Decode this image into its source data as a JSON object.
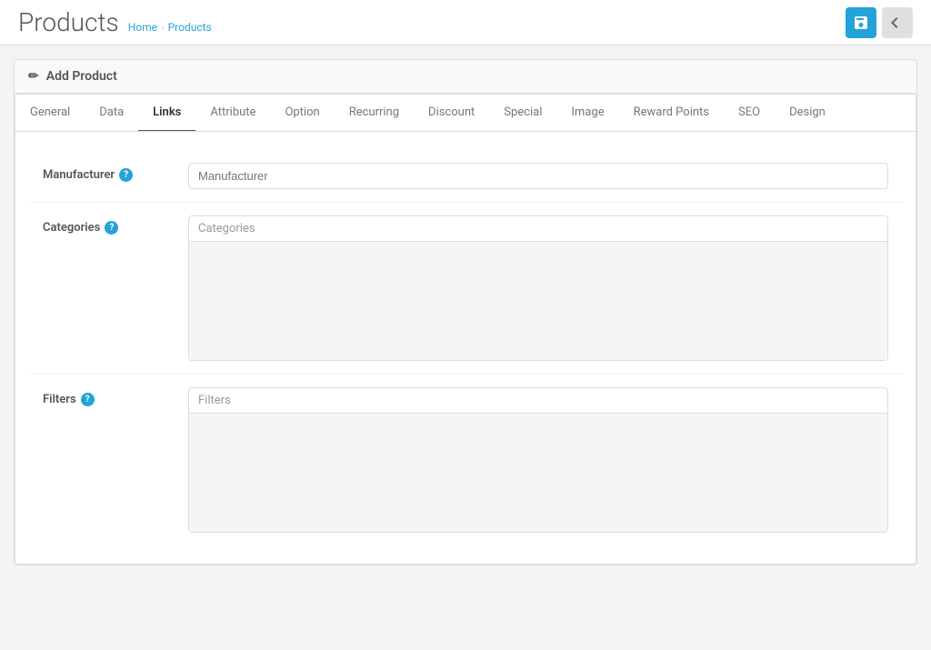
{
  "app": {
    "title": "Products",
    "breadcrumb": {
      "home": "Home",
      "current": "Products"
    }
  },
  "header": {
    "save_label": "💾",
    "back_label": "↩"
  },
  "card": {
    "title": "Add Product",
    "icon": "✏"
  },
  "tabs": [
    {
      "id": "general",
      "label": "General",
      "active": false
    },
    {
      "id": "data",
      "label": "Data",
      "active": false
    },
    {
      "id": "links",
      "label": "Links",
      "active": true
    },
    {
      "id": "attribute",
      "label": "Attribute",
      "active": false
    },
    {
      "id": "option",
      "label": "Option",
      "active": false
    },
    {
      "id": "recurring",
      "label": "Recurring",
      "active": false
    },
    {
      "id": "discount",
      "label": "Discount",
      "active": false
    },
    {
      "id": "special",
      "label": "Special",
      "active": false
    },
    {
      "id": "image",
      "label": "Image",
      "active": false
    },
    {
      "id": "reward-points",
      "label": "Reward Points",
      "active": false
    },
    {
      "id": "seo",
      "label": "SEO",
      "active": false
    },
    {
      "id": "design",
      "label": "Design",
      "active": false
    }
  ],
  "form": {
    "manufacturer": {
      "label": "Manufacturer",
      "placeholder": "Manufacturer",
      "help": "?"
    },
    "categories": {
      "label": "Categories",
      "placeholder": "Categories",
      "help": "?"
    },
    "filters": {
      "label": "Filters",
      "placeholder": "Filters",
      "help": "?"
    }
  }
}
